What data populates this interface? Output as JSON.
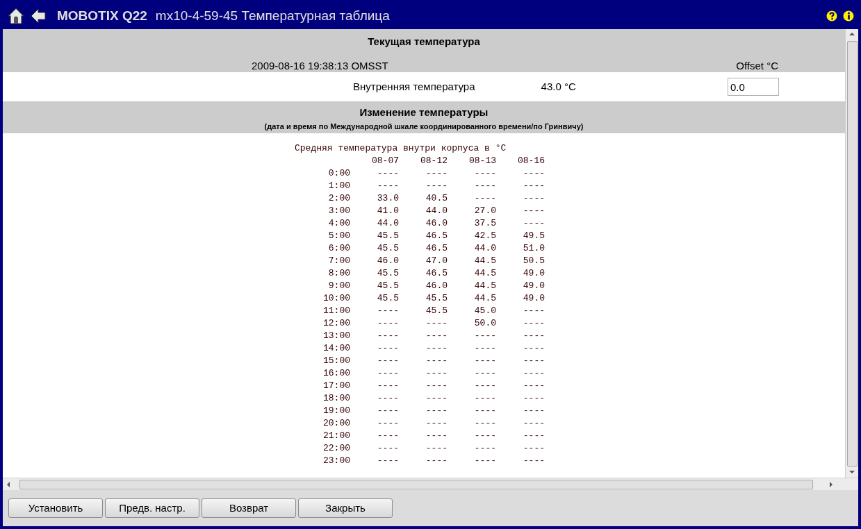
{
  "window": {
    "brand": "MOBOTIX Q22",
    "title": "mx10-4-59-45 Температурная таблица"
  },
  "current": {
    "heading": "Текущая температура",
    "timestamp": "2009-08-16 19:38:13 OMSST",
    "offset_label": "Offset °C",
    "sensor_label": "Внутренняя температура",
    "sensor_value": "43.0 °C",
    "offset_value": "0.0"
  },
  "history": {
    "heading": "Изменение температуры",
    "subheading": "(дата и время по Международной шкале координированного времени/по Гринвичу)",
    "table_title": "Средняя температура внутри корпуса в °C",
    "columns": [
      "08-07",
      "08-12",
      "08-13",
      "08-16"
    ],
    "rows": [
      {
        "time": "0:00",
        "values": [
          "----",
          "----",
          "----",
          "----"
        ]
      },
      {
        "time": "1:00",
        "values": [
          "----",
          "----",
          "----",
          "----"
        ]
      },
      {
        "time": "2:00",
        "values": [
          "33.0",
          "40.5",
          "----",
          "----"
        ]
      },
      {
        "time": "3:00",
        "values": [
          "41.0",
          "44.0",
          "27.0",
          "----"
        ]
      },
      {
        "time": "4:00",
        "values": [
          "44.0",
          "46.0",
          "37.5",
          "----"
        ]
      },
      {
        "time": "5:00",
        "values": [
          "45.5",
          "46.5",
          "42.5",
          "49.5"
        ]
      },
      {
        "time": "6:00",
        "values": [
          "45.5",
          "46.5",
          "44.0",
          "51.0"
        ]
      },
      {
        "time": "7:00",
        "values": [
          "46.0",
          "47.0",
          "44.5",
          "50.5"
        ]
      },
      {
        "time": "8:00",
        "values": [
          "45.5",
          "46.5",
          "44.5",
          "49.0"
        ]
      },
      {
        "time": "9:00",
        "values": [
          "45.5",
          "46.0",
          "44.5",
          "49.0"
        ]
      },
      {
        "time": "10:00",
        "values": [
          "45.5",
          "45.5",
          "44.5",
          "49.0"
        ]
      },
      {
        "time": "11:00",
        "values": [
          "----",
          "45.5",
          "45.0",
          "----"
        ]
      },
      {
        "time": "12:00",
        "values": [
          "----",
          "----",
          "50.0",
          "----"
        ]
      },
      {
        "time": "13:00",
        "values": [
          "----",
          "----",
          "----",
          "----"
        ]
      },
      {
        "time": "14:00",
        "values": [
          "----",
          "----",
          "----",
          "----"
        ]
      },
      {
        "time": "15:00",
        "values": [
          "----",
          "----",
          "----",
          "----"
        ]
      },
      {
        "time": "16:00",
        "values": [
          "----",
          "----",
          "----",
          "----"
        ]
      },
      {
        "time": "17:00",
        "values": [
          "----",
          "----",
          "----",
          "----"
        ]
      },
      {
        "time": "18:00",
        "values": [
          "----",
          "----",
          "----",
          "----"
        ]
      },
      {
        "time": "19:00",
        "values": [
          "----",
          "----",
          "----",
          "----"
        ]
      },
      {
        "time": "20:00",
        "values": [
          "----",
          "----",
          "----",
          "----"
        ]
      },
      {
        "time": "21:00",
        "values": [
          "----",
          "----",
          "----",
          "----"
        ]
      },
      {
        "time": "22:00",
        "values": [
          "----",
          "----",
          "----",
          "----"
        ]
      },
      {
        "time": "23:00",
        "values": [
          "----",
          "----",
          "----",
          "----"
        ]
      }
    ]
  },
  "buttons": [
    "Установить",
    "Предв. настр.",
    "Возврат",
    "Закрыть"
  ]
}
